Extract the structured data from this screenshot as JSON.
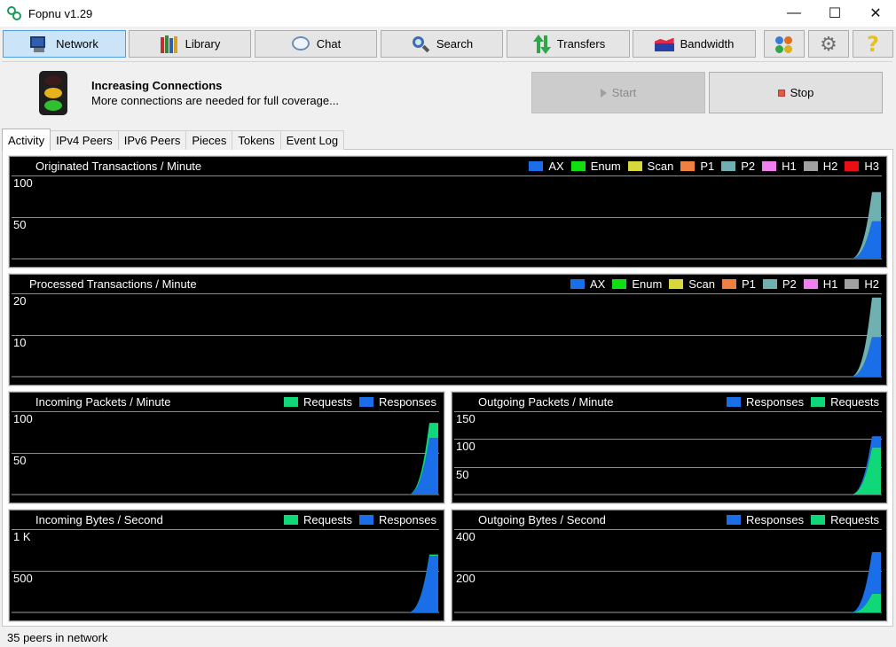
{
  "window": {
    "title": "Fopnu v1.29",
    "minimize": "—",
    "maximize": "☐",
    "close": "✕"
  },
  "toolbar": {
    "buttons": [
      {
        "label": "Network",
        "icon": "network-icon"
      },
      {
        "label": "Library",
        "icon": "library-icon"
      },
      {
        "label": "Chat",
        "icon": "chat-icon"
      },
      {
        "label": "Search",
        "icon": "search-icon"
      },
      {
        "label": "Transfers",
        "icon": "transfers-icon"
      },
      {
        "label": "Bandwidth",
        "icon": "bandwidth-icon"
      }
    ],
    "extra_icons": [
      "users-icon",
      "settings-gear-icon",
      "help-icon"
    ],
    "help_glyph": "?",
    "gear_glyph": "⚙"
  },
  "status": {
    "title": "Increasing Connections",
    "message": "More connections are needed for full coverage...",
    "start_label": "Start",
    "stop_label": "Stop",
    "start_enabled": false,
    "traffic_light": {
      "red": "#3a1a1a",
      "yellow": "#e8b21a",
      "green": "#2ec02e"
    }
  },
  "tabs": [
    "Activity",
    "IPv4 Peers",
    "IPv6 Peers",
    "Pieces",
    "Tokens",
    "Event Log"
  ],
  "active_tab": "Activity",
  "colors": {
    "AX": "#1a6fe8",
    "Enum": "#10e010",
    "Scan": "#d8d83a",
    "P1": "#f08040",
    "P2": "#70b0b0",
    "H1": "#f080f0",
    "H2": "#a0a0a0",
    "H3": "#e81010",
    "Requests": "#10d878",
    "Responses": "#1a6fe8"
  },
  "chart_data": [
    {
      "type": "area",
      "title": "Originated Transactions / Minute",
      "legend": [
        "AX",
        "Enum",
        "Scan",
        "P1",
        "P2",
        "H1",
        "H2",
        "H3"
      ],
      "yticks": [
        "100",
        "50"
      ],
      "ylim": [
        0,
        100
      ],
      "series": [
        {
          "name": "AX",
          "end_value": 45
        },
        {
          "name": "P2",
          "end_value": 35
        }
      ],
      "stack_order": [
        "AX",
        "P2"
      ]
    },
    {
      "type": "area",
      "title": "Processed Transactions / Minute",
      "legend": [
        "AX",
        "Enum",
        "Scan",
        "P1",
        "P2",
        "H1",
        "H2"
      ],
      "yticks": [
        "20",
        "10"
      ],
      "ylim": [
        0,
        20
      ],
      "series": [
        {
          "name": "AX",
          "end_value": 9.5
        },
        {
          "name": "P2",
          "end_value": 9.5
        }
      ],
      "stack_order": [
        "AX",
        "P2"
      ]
    },
    {
      "type": "area",
      "title": "Incoming Packets / Minute",
      "legend": [
        "Requests",
        "Responses"
      ],
      "yticks": [
        "100",
        "50"
      ],
      "ylim": [
        0,
        100
      ],
      "series": [
        {
          "name": "Responses",
          "end_value": 68
        },
        {
          "name": "Requests",
          "end_value": 18
        }
      ],
      "stack_order": [
        "Responses",
        "Requests"
      ]
    },
    {
      "type": "area",
      "title": "Outgoing Packets / Minute",
      "legend": [
        "Responses",
        "Requests"
      ],
      "yticks": [
        "150",
        "100",
        "50"
      ],
      "ylim": [
        0,
        150
      ],
      "series": [
        {
          "name": "Requests",
          "end_value": 85
        },
        {
          "name": "Responses",
          "end_value": 20
        }
      ],
      "stack_order": [
        "Requests",
        "Responses"
      ]
    },
    {
      "type": "area",
      "title": "Incoming Bytes / Second",
      "legend": [
        "Requests",
        "Responses"
      ],
      "yticks": [
        "1 K",
        "500"
      ],
      "ylim": [
        0,
        1000
      ],
      "series": [
        {
          "name": "Responses",
          "end_value": 680
        },
        {
          "name": "Requests",
          "end_value": 15
        }
      ],
      "stack_order": [
        "Responses",
        "Requests"
      ]
    },
    {
      "type": "area",
      "title": "Outgoing Bytes / Second",
      "legend": [
        "Responses",
        "Requests"
      ],
      "yticks": [
        "400",
        "200"
      ],
      "ylim": [
        0,
        400
      ],
      "series": [
        {
          "name": "Requests",
          "end_value": 90
        },
        {
          "name": "Responses",
          "end_value": 200
        }
      ],
      "stack_order": [
        "Requests",
        "Responses"
      ]
    }
  ],
  "statusbar": {
    "text": "35 peers in network"
  }
}
